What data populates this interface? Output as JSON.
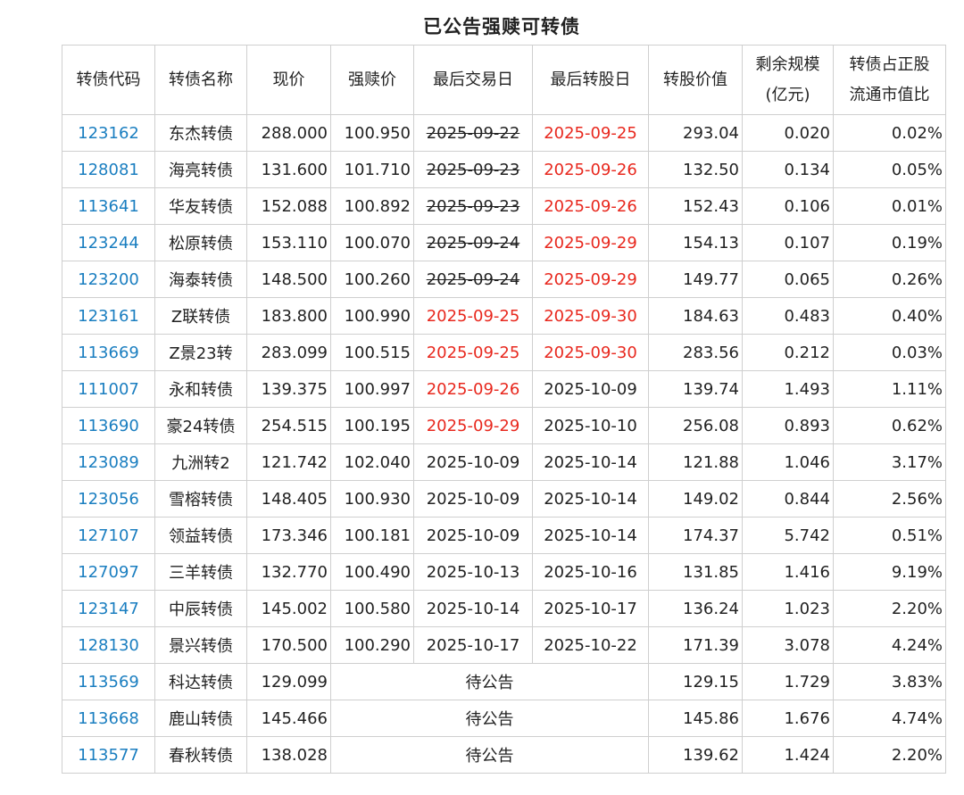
{
  "title": "已公告强赎可转债",
  "headers": {
    "code": "转债代码",
    "name": "转债名称",
    "price": "现价",
    "redeem_price": "强赎价",
    "last_trade": "最后交易日",
    "last_convert": "最后转股日",
    "convert_value": "转股价值",
    "remaining_l1": "剩余规模",
    "remaining_l2": "(亿元)",
    "ratio_l1": "转债占正股",
    "ratio_l2": "流通市值比"
  },
  "colors": {
    "link": "#1a7ec0",
    "alert_red": "#e8281e",
    "border": "#cfcfcf"
  },
  "rows": [
    {
      "code": "123162",
      "name": "东杰转债",
      "price": "288.000",
      "redeem": "100.950",
      "last_trade": "2025-09-22",
      "trade_style": "strike",
      "last_convert": "2025-09-25",
      "convert_style": "red",
      "value": "293.04",
      "remain": "0.020",
      "ratio": "0.02%"
    },
    {
      "code": "128081",
      "name": "海亮转债",
      "price": "131.600",
      "redeem": "101.710",
      "last_trade": "2025-09-23",
      "trade_style": "strike",
      "last_convert": "2025-09-26",
      "convert_style": "red",
      "value": "132.50",
      "remain": "0.134",
      "ratio": "0.05%"
    },
    {
      "code": "113641",
      "name": "华友转债",
      "price": "152.088",
      "redeem": "100.892",
      "last_trade": "2025-09-23",
      "trade_style": "strike",
      "last_convert": "2025-09-26",
      "convert_style": "red",
      "value": "152.43",
      "remain": "0.106",
      "ratio": "0.01%"
    },
    {
      "code": "123244",
      "name": "松原转债",
      "price": "153.110",
      "redeem": "100.070",
      "last_trade": "2025-09-24",
      "trade_style": "strike",
      "last_convert": "2025-09-29",
      "convert_style": "red",
      "value": "154.13",
      "remain": "0.107",
      "ratio": "0.19%"
    },
    {
      "code": "123200",
      "name": "海泰转债",
      "price": "148.500",
      "redeem": "100.260",
      "last_trade": "2025-09-24",
      "trade_style": "strike",
      "last_convert": "2025-09-29",
      "convert_style": "red",
      "value": "149.77",
      "remain": "0.065",
      "ratio": "0.26%"
    },
    {
      "code": "123161",
      "name": "Z联转债",
      "price": "183.800",
      "redeem": "100.990",
      "last_trade": "2025-09-25",
      "trade_style": "red",
      "last_convert": "2025-09-30",
      "convert_style": "red",
      "value": "184.63",
      "remain": "0.483",
      "ratio": "0.40%"
    },
    {
      "code": "113669",
      "name": "Z景23转",
      "price": "283.099",
      "redeem": "100.515",
      "last_trade": "2025-09-25",
      "trade_style": "red",
      "last_convert": "2025-09-30",
      "convert_style": "red",
      "value": "283.56",
      "remain": "0.212",
      "ratio": "0.03%"
    },
    {
      "code": "111007",
      "name": "永和转债",
      "price": "139.375",
      "redeem": "100.997",
      "last_trade": "2025-09-26",
      "trade_style": "red",
      "last_convert": "2025-10-09",
      "convert_style": "normal",
      "value": "139.74",
      "remain": "1.493",
      "ratio": "1.11%"
    },
    {
      "code": "113690",
      "name": "豪24转债",
      "price": "254.515",
      "redeem": "100.195",
      "last_trade": "2025-09-29",
      "trade_style": "red",
      "last_convert": "2025-10-10",
      "convert_style": "normal",
      "value": "256.08",
      "remain": "0.893",
      "ratio": "0.62%"
    },
    {
      "code": "123089",
      "name": "九洲转2",
      "price": "121.742",
      "redeem": "102.040",
      "last_trade": "2025-10-09",
      "trade_style": "normal",
      "last_convert": "2025-10-14",
      "convert_style": "normal",
      "value": "121.88",
      "remain": "1.046",
      "ratio": "3.17%"
    },
    {
      "code": "123056",
      "name": "雪榕转债",
      "price": "148.405",
      "redeem": "100.930",
      "last_trade": "2025-10-09",
      "trade_style": "normal",
      "last_convert": "2025-10-14",
      "convert_style": "normal",
      "value": "149.02",
      "remain": "0.844",
      "ratio": "2.56%"
    },
    {
      "code": "127107",
      "name": "领益转债",
      "price": "173.346",
      "redeem": "100.181",
      "last_trade": "2025-10-09",
      "trade_style": "normal",
      "last_convert": "2025-10-14",
      "convert_style": "normal",
      "value": "174.37",
      "remain": "5.742",
      "ratio": "0.51%"
    },
    {
      "code": "127097",
      "name": "三羊转债",
      "price": "132.770",
      "redeem": "100.490",
      "last_trade": "2025-10-13",
      "trade_style": "normal",
      "last_convert": "2025-10-16",
      "convert_style": "normal",
      "value": "131.85",
      "remain": "1.416",
      "ratio": "9.19%"
    },
    {
      "code": "123147",
      "name": "中辰转债",
      "price": "145.002",
      "redeem": "100.580",
      "last_trade": "2025-10-14",
      "trade_style": "normal",
      "last_convert": "2025-10-17",
      "convert_style": "normal",
      "value": "136.24",
      "remain": "1.023",
      "ratio": "2.20%"
    },
    {
      "code": "128130",
      "name": "景兴转债",
      "price": "170.500",
      "redeem": "100.290",
      "last_trade": "2025-10-17",
      "trade_style": "normal",
      "last_convert": "2025-10-22",
      "convert_style": "normal",
      "value": "171.39",
      "remain": "3.078",
      "ratio": "4.24%"
    },
    {
      "code": "113569",
      "name": "科达转债",
      "price": "129.099",
      "pending": "待公告",
      "value": "129.15",
      "remain": "1.729",
      "ratio": "3.83%"
    },
    {
      "code": "113668",
      "name": "鹿山转债",
      "price": "145.466",
      "pending": "待公告",
      "value": "145.86",
      "remain": "1.676",
      "ratio": "4.74%"
    },
    {
      "code": "113577",
      "name": "春秋转债",
      "price": "138.028",
      "pending": "待公告",
      "value": "139.62",
      "remain": "1.424",
      "ratio": "2.20%"
    }
  ]
}
